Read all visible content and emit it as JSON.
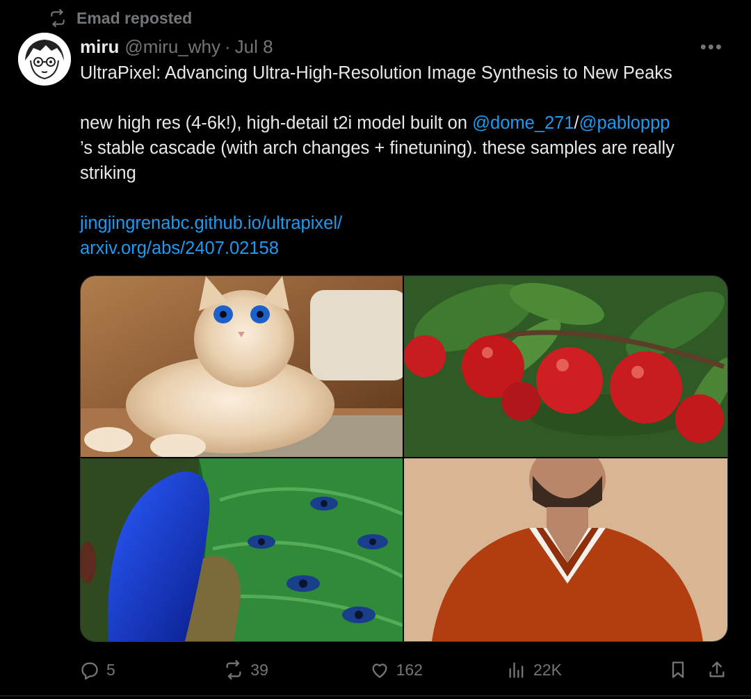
{
  "repost": {
    "icon": "repost-icon",
    "text": "Emad reposted"
  },
  "author": {
    "name": "miru",
    "handle": "@miru_why",
    "separator": "·",
    "date": "Jul 8",
    "avatar_icon": "avatar-anime-sketch"
  },
  "more_label": "•••",
  "post": {
    "title": "UltraPixel: Advancing Ultra-High-Resolution Image Synthesis to New Peaks",
    "body_pre": "new high res (4-6k!), high-detail t2i model built on ",
    "mention1": "@dome_271",
    "slash": "/",
    "mention2": "@pabloppp",
    "body_post": "’s stable cascade (with arch changes + finetuning). these samples are really striking",
    "link1": "jingjingrenabc.github.io/ultrapixel/",
    "link2": "arxiv.org/abs/2407.02158"
  },
  "media": [
    {
      "subject": "fluffy cream cat with blue eyes on a rug"
    },
    {
      "subject": "red apples on a tree branch"
    },
    {
      "subject": "blue peacock with green feathers"
    },
    {
      "subject": "bearded man in orange v-neck sweater"
    }
  ],
  "actions": {
    "replies": "5",
    "reposts": "39",
    "likes": "162",
    "views": "22K"
  },
  "colors": {
    "background": "#000000",
    "text": "#e7e9ea",
    "muted": "#71767b",
    "link": "#1d9bf0"
  }
}
